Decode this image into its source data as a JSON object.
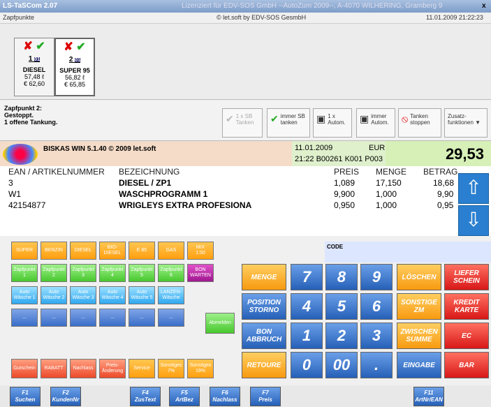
{
  "window": {
    "title": "LS-TaSCom 2.07",
    "license": "Lizenziert für EDV-SOS GmbH --AutoZum 2009--, A-4070 WILHERING, Gramberg 9",
    "close": "x"
  },
  "subbar": {
    "left": "Zapfpunkte",
    "center": "© let.soft by EDV-SOS GesmbH",
    "right": "11.01.2009 21:22:23"
  },
  "pumps": [
    {
      "num": "1",
      "badge": "01",
      "product": "DIESEL",
      "volume": "57,48 ℓ",
      "amount": "€ 62,60"
    },
    {
      "num": "2",
      "badge": "01",
      "product": "SUPER 95",
      "volume": "56,82 ℓ",
      "amount": "€ 65,85"
    }
  ],
  "status": {
    "message": "Zapfpunkt 2:\nGestoppt.\n1 offene Tankung."
  },
  "toolbar": {
    "b1": "1 x SB\nTanken",
    "b2": "immer SB\ntanken",
    "b3": "1 x\nAutom.",
    "b4": "immer\nAutom.",
    "b5": "Tanken\nstoppen",
    "b6": "Zusatz-\nfunktionen"
  },
  "header": {
    "version": "BISKAS WIN 5.1.40 © 2009 let.soft",
    "date": "11.01.2009",
    "currency": "EUR",
    "time_line": "21:22  B00261 K001 P003",
    "total": "29,53"
  },
  "table": {
    "headers": [
      "EAN / ARTIKELNUMMER",
      "BEZEICHNUNG",
      "PREIS",
      "MENGE",
      "BETRAG"
    ],
    "rows": [
      [
        "3",
        "DIESEL / ZP1",
        "1,089",
        "17,150",
        "18,68"
      ],
      [
        "W1",
        "WASCHPROGRAMM 1",
        "9,900",
        "1,000",
        "9,90"
      ],
      [
        "42154877",
        "WRIGLEYS EXTRA PROFESIONA",
        "0,950",
        "1,000",
        "0,95"
      ]
    ]
  },
  "keys": {
    "fuel": [
      "SUPER",
      "BENZIN",
      "DIESEL",
      "BIO-\nDIESEL",
      "E 85",
      "GAS",
      "MIX\n1:50"
    ],
    "zapf": [
      "Zapfpunkt\n1",
      "Zapfpunkt\n2",
      "Zapfpunkt\n3",
      "Zapfpunkt\n4",
      "Zapfpunkt\n5",
      "Zapfpunkt\n6",
      "BON\nWARTEN"
    ],
    "wash": [
      "Auto\nWäsche 1",
      "Auto\nWäsche 2",
      "Auto\nWäsche 3",
      "Auto\nWäsche 4",
      "Auto\nWäsche 5",
      "LANZEN-\nWäsche"
    ],
    "blank": [
      "...",
      "...",
      "...",
      "...",
      "...",
      "..."
    ],
    "abmelden": "Abmelden",
    "bottom": [
      "Gutschein",
      "RABATT",
      "Nachlass",
      "Preis-\nÄnderung",
      "Service",
      "Sonstiges\n7%",
      "Sonstiges\n19%"
    ],
    "menge": "MENGE",
    "storno": "POSITION\nSTORNO",
    "abbruch": "BON\nABBRUCH",
    "retoure": "RETOURE",
    "digits": [
      "7",
      "8",
      "9",
      "4",
      "5",
      "6",
      "1",
      "2",
      "3",
      "0",
      "00",
      "."
    ],
    "loeschen": "LÖSCHEN",
    "sonstige": "SONSTIGE\nZM",
    "zwischen": "ZWISCHEN\nSUMME",
    "eingabe": "EINGABE",
    "liefer": "LIEFER\nSCHEIN",
    "kredit": "KREDIT\nKARTE",
    "ec": "EC",
    "bar": "BAR",
    "code": "CODE"
  },
  "fkeys": [
    {
      "k": "F1",
      "l": "Suchen"
    },
    {
      "k": "F2",
      "l": "KundenNr"
    },
    {
      "k": "F4",
      "l": "ZusText"
    },
    {
      "k": "F5",
      "l": "ArtBez"
    },
    {
      "k": "F6",
      "l": "Nachlass"
    },
    {
      "k": "F7",
      "l": "Preis"
    },
    {
      "k": "F11",
      "l": "ArtNr/EAN"
    }
  ]
}
